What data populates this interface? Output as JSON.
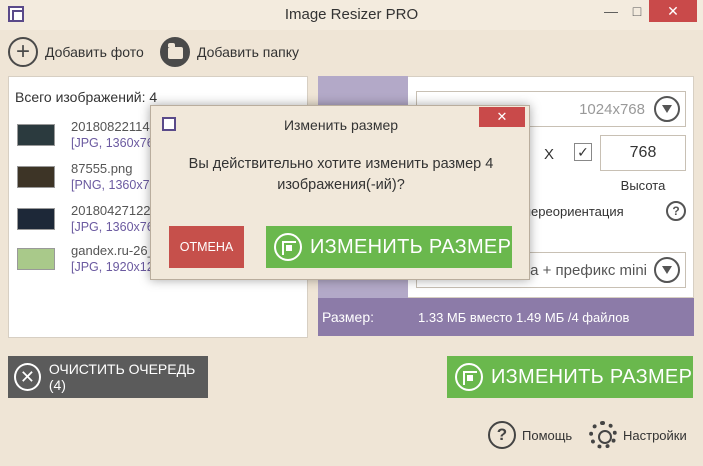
{
  "window": {
    "title": "Image Resizer PRO",
    "minimize_glyph": "—",
    "maximize_glyph": "□",
    "close_glyph": "✕"
  },
  "toolbar": {
    "add_photo_label": "Добавить фото",
    "add_folder_label": "Добавить папку"
  },
  "file_list": {
    "total_label": "Всего изображений: 4",
    "items": [
      {
        "name": "20180822114",
        "meta": "[JPG, 1360x76",
        "thumb_color": "#2b3a3e"
      },
      {
        "name": "87555.png",
        "meta": "[PNG, 1360x7",
        "thumb_color": "#3d3426"
      },
      {
        "name": "20180427122",
        "meta": "[JPG, 1360x76",
        "thumb_color": "#1d2838"
      },
      {
        "name": "gandex.ru-26_",
        "meta": "[JPG, 1920x12",
        "thumb_color": "#a9c98a"
      }
    ]
  },
  "settings": {
    "preset_value": "1024x768",
    "x_label": "X",
    "check_glyph": "✓",
    "height_value": "768",
    "height_label": "Высота",
    "orientation_label": "переориентация",
    "help_glyph": "?",
    "naming_value": "а + префикс mini"
  },
  "size_bar": {
    "label": "Размер:",
    "value": "1.33 МБ вместо 1.49 МБ /4 файлов"
  },
  "actions": {
    "clear_label": "ОЧИСТИТЬ ОЧЕРЕДЬ (4)",
    "clear_glyph": "✕",
    "resize_label": "ИЗМЕНИТЬ РАЗМЕР"
  },
  "footer": {
    "help_label": "Помощь",
    "help_glyph": "?",
    "settings_label": "Настройки"
  },
  "dialog": {
    "title": "Изменить размер",
    "close_glyph": "✕",
    "message_line1": "Вы действительно хотите изменить размер 4",
    "message_line2": "изображения(-ий)?",
    "cancel_label": "ОТМЕНА",
    "ok_label": "ИЗМЕНИТЬ РАЗМЕР"
  },
  "colors": {
    "background": "#efe5d6",
    "accent_purple": "#8c7ba8",
    "accent_green": "#6ab84d",
    "danger_red": "#c6504b",
    "dark_button": "#5b5b5b"
  }
}
